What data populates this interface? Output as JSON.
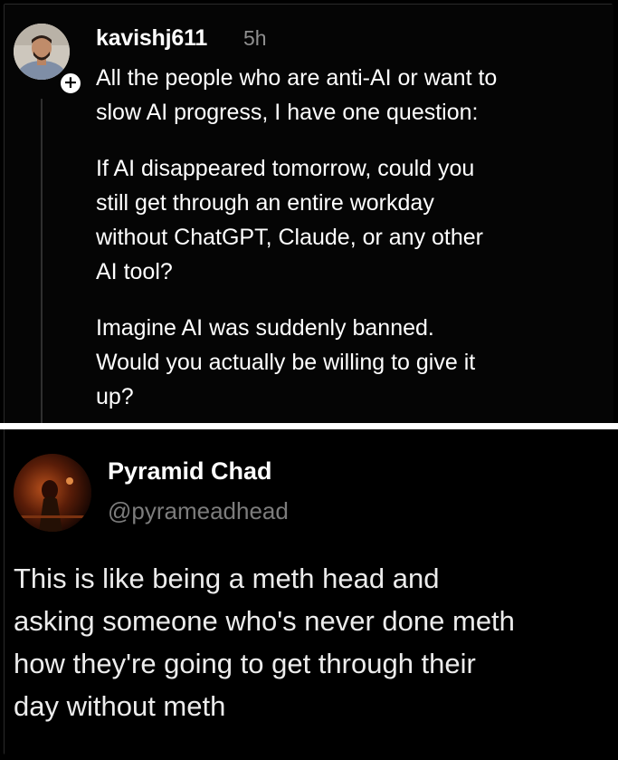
{
  "post_1": {
    "username": "kavishj611",
    "time": "5h",
    "follow_badge": "+",
    "paragraphs": [
      [
        "All the people who are anti-AI or want to",
        "slow AI progress, I have one question:"
      ],
      [
        "If AI disappeared tomorrow, could you",
        "still get through an entire workday",
        "without ChatGPT, Claude, or any other",
        "AI tool?"
      ],
      [
        "Imagine AI was suddenly banned.",
        "Would you actually be willing to give it",
        "up?"
      ]
    ]
  },
  "post_2": {
    "display_name": "Pyramid Chad",
    "handle": "@pyrameadhead",
    "text_lines": [
      "This is like being a meth head and",
      "asking someone who's never done meth",
      "how they're going to get through their",
      "day without meth"
    ]
  },
  "colors": {
    "background": "#000000",
    "primary_text": "#ffffff",
    "secondary_text": "#8f8f8f",
    "divider": "#ffffff"
  }
}
